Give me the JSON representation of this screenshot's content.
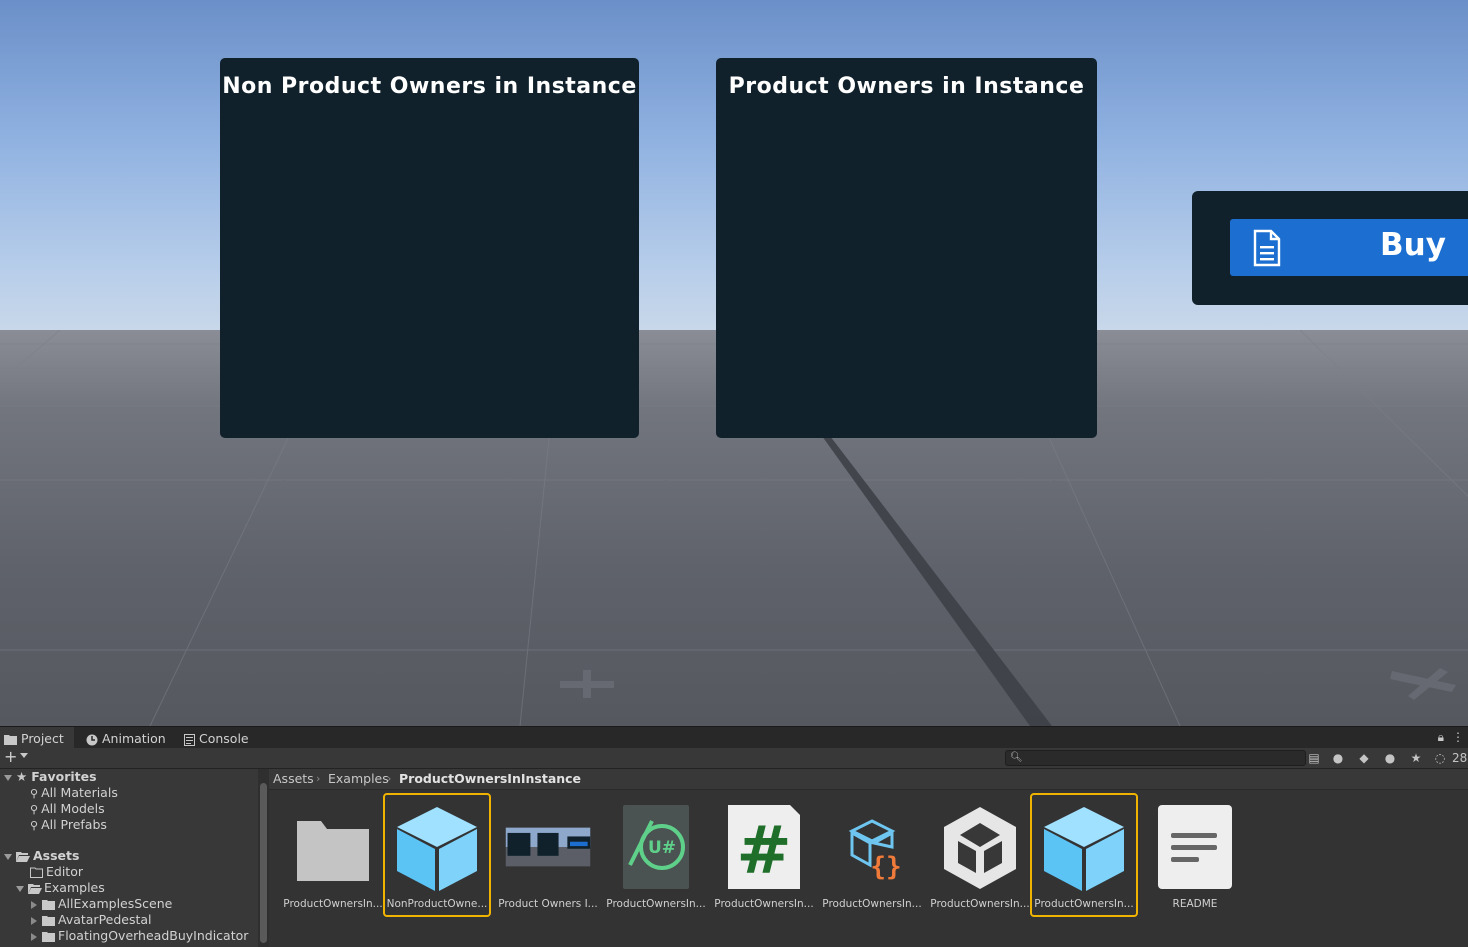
{
  "scene": {
    "panel_left_title": "Non Product Owners in Instance",
    "panel_right_title": "Product Owners in Instance",
    "buy_label": "Buy"
  },
  "editor": {
    "tabs": [
      {
        "label": "Project",
        "icon": "folder-icon",
        "active": true
      },
      {
        "label": "Animation",
        "icon": "clock-icon",
        "active": false
      },
      {
        "label": "Console",
        "icon": "console-icon",
        "active": false
      }
    ],
    "hidden_count": "28",
    "search_placeholder": "",
    "tree": {
      "favorites_label": "Favorites",
      "favorites": [
        "All Materials",
        "All Models",
        "All Prefabs"
      ],
      "assets_label": "Assets",
      "editor_folder": "Editor",
      "examples_folder": "Examples",
      "example_children": [
        "AllExamplesScene",
        "AvatarPedestal",
        "FloatingOverheadBuyIndicator"
      ]
    },
    "breadcrumb": [
      "Assets",
      "Examples",
      "ProductOwnersInInstance"
    ],
    "assets": [
      {
        "label": "ProductOwnersIn...",
        "kind": "folder-icon",
        "selected": false
      },
      {
        "label": "NonProductOwne...",
        "kind": "prefab-cube-icon",
        "selected": true
      },
      {
        "label": "Product Owners I...",
        "kind": "scene-preview-icon",
        "selected": false
      },
      {
        "label": "ProductOwnersIn...",
        "kind": "udon-sharp-icon",
        "selected": false
      },
      {
        "label": "ProductOwnersIn...",
        "kind": "csharp-script-icon",
        "selected": false
      },
      {
        "label": "ProductOwnersIn...",
        "kind": "udon-program-icon",
        "selected": false
      },
      {
        "label": "ProductOwnersIn...",
        "kind": "unity-scene-icon",
        "selected": false
      },
      {
        "label": "ProductOwnersIn...",
        "kind": "prefab-cube-icon",
        "selected": true
      },
      {
        "label": "README",
        "kind": "text-document-icon",
        "selected": false
      }
    ]
  }
}
